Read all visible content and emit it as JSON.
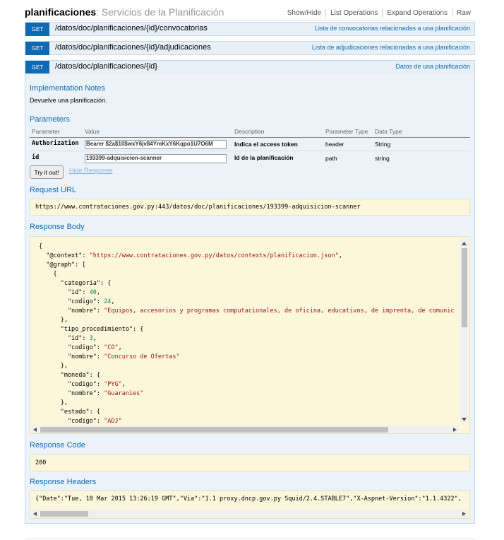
{
  "header": {
    "resource": "planificaciones",
    "description": ": Servicios de la Planificación",
    "ops": [
      "Show/Hide",
      "List Operations",
      "Expand Operations",
      "Raw"
    ]
  },
  "endpoints": [
    {
      "method": "GET",
      "path": "/datos/doc/planificaciones/{id}/convocatorias",
      "summary": "Lista de convocatorias relacionadas a una planificación"
    },
    {
      "method": "GET",
      "path": "/datos/doc/planificaciones/{id}/adjudicaciones",
      "summary": "Lista de adjudicaciones relacionadas a una planificación"
    },
    {
      "method": "GET",
      "path": "/datos/doc/planificaciones/{id}",
      "summary": "Datos de una planificación"
    }
  ],
  "notes": {
    "title": "Implementation Notes",
    "text": "Devuelve una planificación."
  },
  "params": {
    "title": "Parameters",
    "headers": [
      "Parameter",
      "Value",
      "Description",
      "Parameter Type",
      "Data Type"
    ],
    "rows": [
      {
        "name": "Authorization",
        "value": "Bearer $2a$10$wxY6jv84YmKxY6Kqpo1U7O6M",
        "description": "Indica el access token",
        "ptype": "header",
        "dtype": "String"
      },
      {
        "name": "id",
        "value": "193399-adquisicion-scanner",
        "description": "Id de la planificación",
        "ptype": "path",
        "dtype": "string"
      }
    ]
  },
  "actions": {
    "try": "Try it out!",
    "hide": "Hide Response"
  },
  "request_url": {
    "title": "Request URL",
    "value": "https://www.contrataciones.gov.py:443/datos/doc/planificaciones/193399-adquisicion-scanner"
  },
  "response_body": {
    "title": "Response Body",
    "lines": [
      [
        [
          "k",
          "{"
        ]
      ],
      [
        [
          "k",
          "  \"@context\": "
        ],
        [
          "s",
          "\"https://www.contrataciones.gov.py/datos/contexts/planificacion.json\""
        ],
        [
          "k",
          ","
        ]
      ],
      [
        [
          "k",
          "  \"@graph\": ["
        ]
      ],
      [
        [
          "k",
          "    {"
        ]
      ],
      [
        [
          "k",
          "      \"categoria\": {"
        ]
      ],
      [
        [
          "k",
          "        \"id\": "
        ],
        [
          "n",
          "40"
        ],
        [
          "k",
          ","
        ]
      ],
      [
        [
          "k",
          "        \"codigo\": "
        ],
        [
          "n",
          "24"
        ],
        [
          "k",
          ","
        ]
      ],
      [
        [
          "k",
          "        \"nombre\": "
        ],
        [
          "s",
          "\"Equipos, accesorios y programas computacionales, de oficina, educativos, de imprenta, de comunic"
        ]
      ],
      [
        [
          "k",
          "      },"
        ]
      ],
      [
        [
          "k",
          "      \"tipo_procedimiento\": {"
        ]
      ],
      [
        [
          "k",
          "        \"id\": "
        ],
        [
          "n",
          "3"
        ],
        [
          "k",
          ","
        ]
      ],
      [
        [
          "k",
          "        \"codigo\": "
        ],
        [
          "s",
          "\"CO\""
        ],
        [
          "k",
          ","
        ]
      ],
      [
        [
          "k",
          "        \"nombre\": "
        ],
        [
          "s",
          "\"Concurso de Ofertas\""
        ]
      ],
      [
        [
          "k",
          "      },"
        ]
      ],
      [
        [
          "k",
          "      \"moneda\": {"
        ]
      ],
      [
        [
          "k",
          "        \"codigo\": "
        ],
        [
          "s",
          "\"PYG\""
        ],
        [
          "k",
          ","
        ]
      ],
      [
        [
          "k",
          "        \"nombre\": "
        ],
        [
          "s",
          "\"Guaranies\""
        ]
      ],
      [
        [
          "k",
          "      },"
        ]
      ],
      [
        [
          "k",
          "      \"estado\": {"
        ]
      ],
      [
        [
          "k",
          "        \"codigo\": "
        ],
        [
          "s",
          "\"ADJ\""
        ]
      ]
    ]
  },
  "response_code": {
    "title": "Response Code",
    "value": "200"
  },
  "response_headers": {
    "title": "Response Headers",
    "value": "{\"Date\":\"Tue, 10 Mar 2015 13:26:19 GMT\",\"Via\":\"1.1 proxy.dncp.gov.py Squid/2.4.STABLE7\",\"X-Aspnet-Version\":\"1.1.4322\","
  },
  "colors": {
    "method_get": "#0f6ab4",
    "bar_bg": "#e7f0f7",
    "code_bg": "#fcf6db",
    "string": "#a31515",
    "number": "#098658"
  }
}
